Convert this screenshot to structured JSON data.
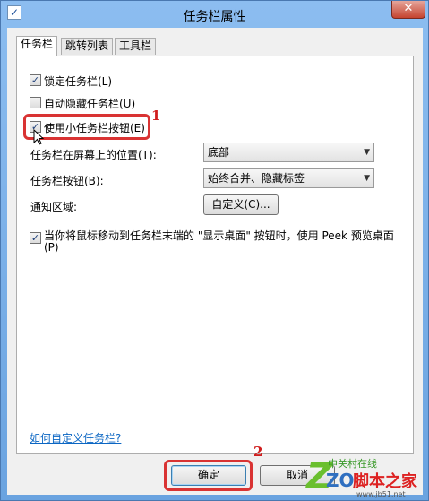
{
  "window": {
    "title": "任务栏属性",
    "close_label": "✕"
  },
  "tabs": [
    {
      "label": "任务栏",
      "active": true
    },
    {
      "label": "跳转列表",
      "active": false
    },
    {
      "label": "工具栏",
      "active": false
    }
  ],
  "options": {
    "lock_taskbar": {
      "label": "锁定任务栏(L)",
      "checked": true
    },
    "auto_hide": {
      "label": "自动隐藏任务栏(U)",
      "checked": false
    },
    "small_buttons": {
      "label": "使用小任务栏按钮(E)",
      "checked": true
    }
  },
  "location": {
    "label": "任务栏在屏幕上的位置(T):",
    "value": "底部"
  },
  "buttons_setting": {
    "label": "任务栏按钮(B):",
    "value": "始终合并、隐藏标签"
  },
  "notification": {
    "label": "通知区域:",
    "button": "自定义(C)..."
  },
  "peek": {
    "line1": "当你将鼠标移动到任务栏末端的 \"显示桌面\" 按钮时，使用 Peek 预览桌面",
    "line2": "(P)",
    "checked": true
  },
  "help_link": "如何自定义任务栏?",
  "footer": {
    "ok": "确定",
    "cancel": "取消"
  },
  "callouts": {
    "first": "1",
    "second": "2"
  },
  "watermark": {
    "cn": "中关村在线",
    "brand": "脚本之家",
    "url": "www.jb51.net",
    "letters": "ZO"
  }
}
